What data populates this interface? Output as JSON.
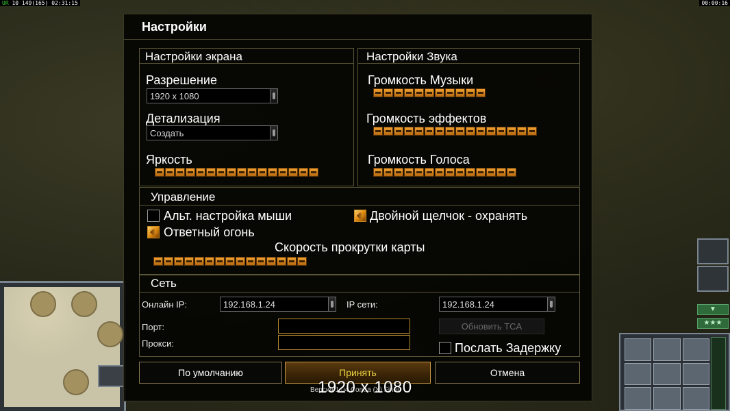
{
  "hud": {
    "fps_tag": "UR",
    "stats": " 10 149(165) 02:31:15",
    "timer": "00:00:16"
  },
  "dialog": {
    "title": "Настройки"
  },
  "display": {
    "group_title": "Настройки экрана",
    "resolution_label": "Разрешение",
    "resolution_value": "1920 x 1080",
    "detail_label": "Детализация",
    "detail_value": "Создать",
    "brightness_label": "Яркость",
    "brightness_level": 16
  },
  "sound": {
    "group_title": "Настройки Звука",
    "music_label": "Громкость Музыки",
    "music_level": 11,
    "effects_label": "Громкость эффектов",
    "effects_level": 16,
    "voice_label": "Громкость Голоса",
    "voice_level": 14
  },
  "controls": {
    "group_title": "Управление",
    "alt_mouse_label": "Альт. настройка мыши",
    "alt_mouse_checked": false,
    "double_click_label": "Двойной щелчок - охранять",
    "double_click_checked": true,
    "return_fire_label": "Ответный огонь",
    "return_fire_checked": true,
    "scroll_speed_label": "Скорость прокрутки карты",
    "scroll_speed_level": 15
  },
  "network": {
    "group_title": "Сеть",
    "online_ip_label": "Онлайн IP:",
    "online_ip_value": "192.168.1.24",
    "lan_ip_label": "IP сети:",
    "lan_ip_value": "192.168.1.24",
    "port_label": "Порт:",
    "port_value": "",
    "proxy_label": "Прокси:",
    "proxy_value": "",
    "update_tca_label": "Обновить TCA",
    "send_delay_label": "Послать Задержку",
    "send_delay_checked": false
  },
  "buttons": {
    "default_label": "По умолчанию",
    "accept_label": "Принять",
    "cancel_label": "Отмена"
  },
  "footer": {
    "version_text": "Версия 1.04 Contra (X) Final",
    "resolution_overlay": "1920 x 1080"
  },
  "colors": {
    "slider_orange": "#e08a10",
    "accept_text": "#e8d040",
    "panel_border": "#5c5638"
  }
}
